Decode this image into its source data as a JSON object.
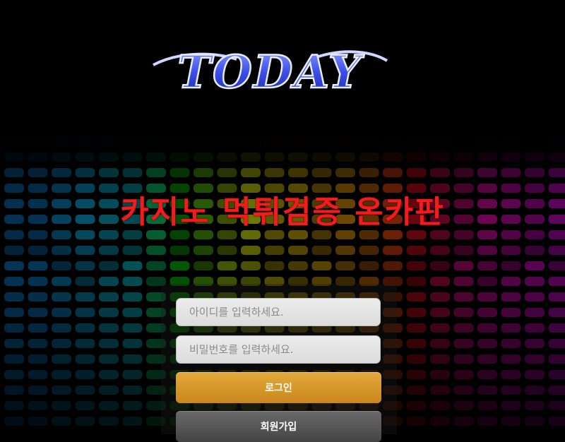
{
  "logo": {
    "text": "TODAY",
    "icon": "today-logo"
  },
  "headline": "카지노 먹튀검증 온카판",
  "form": {
    "username_placeholder": "아이디를 입력하세요.",
    "password_placeholder": "비밀번호를 입력하세요.",
    "username_value": "",
    "password_value": ""
  },
  "buttons": {
    "login_label": "로그인",
    "join_label": "회원가입"
  },
  "colors": {
    "headline": "#f31b1b",
    "login_button": "#d6962a",
    "join_button": "#555555",
    "logo_blue": "#4a5cf0"
  }
}
